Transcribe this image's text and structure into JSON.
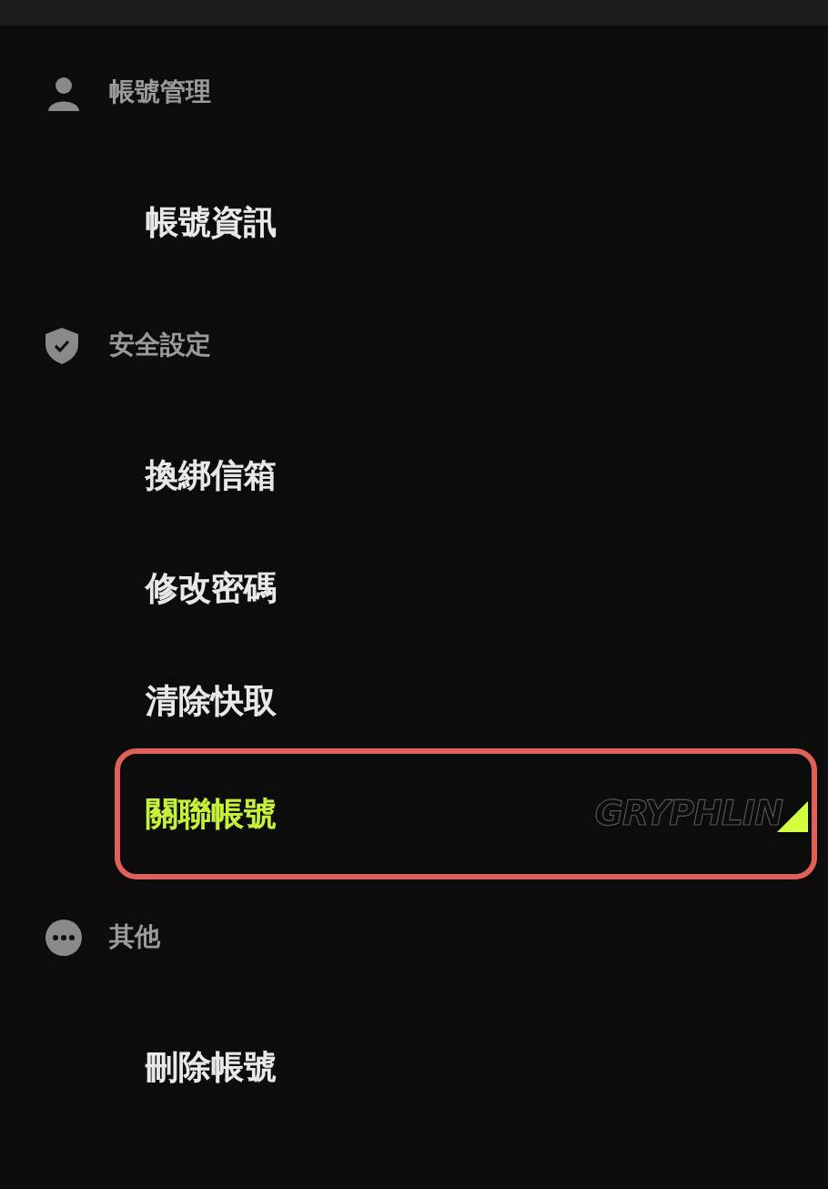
{
  "sections": [
    {
      "kind": "account",
      "title": "帳號管理",
      "items": [
        {
          "label": "帳號資訊",
          "selected": false
        }
      ]
    },
    {
      "kind": "security",
      "title": "安全設定",
      "items": [
        {
          "label": "換綁信箱",
          "selected": false
        },
        {
          "label": "修改密碼",
          "selected": false
        },
        {
          "label": "清除快取",
          "selected": false
        },
        {
          "label": "關聯帳號",
          "selected": true,
          "brand": "GRYPHLIN"
        }
      ]
    },
    {
      "kind": "other",
      "title": "其他",
      "items": [
        {
          "label": "刪除帳號",
          "selected": false
        }
      ]
    }
  ]
}
